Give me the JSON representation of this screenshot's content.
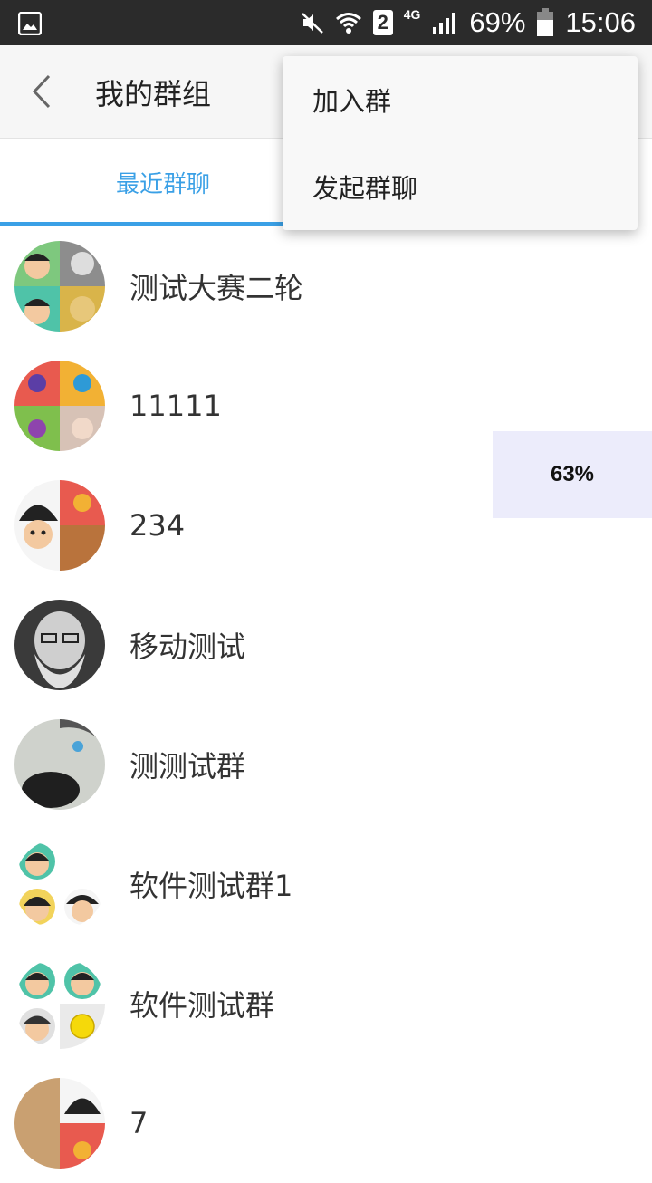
{
  "status_bar": {
    "battery": "69%",
    "time": "15:06",
    "sim_slot": "2",
    "network": "4G",
    "icons": [
      "image-icon",
      "mute-icon",
      "wifi-icon",
      "sim-icon",
      "signal-icon",
      "battery-icon"
    ]
  },
  "header": {
    "title": "我的群组",
    "back_icon": "chevron-left-icon"
  },
  "tabs": [
    {
      "label": "最近群聊",
      "active": true
    }
  ],
  "menu": {
    "items": [
      {
        "label": "加入群"
      },
      {
        "label": "发起群聊"
      }
    ]
  },
  "groups": [
    {
      "name": "测试大赛二轮"
    },
    {
      "name": "11111"
    },
    {
      "name": "234"
    },
    {
      "name": "移动测试"
    },
    {
      "name": "测测试群"
    },
    {
      "name": "软件测试群1"
    },
    {
      "name": "软件测试群"
    },
    {
      "name": "7"
    }
  ],
  "overlay": {
    "percent": "63%"
  },
  "colors": {
    "accent": "#3aa0e6",
    "status_bar": "#2b2b2b",
    "app_bar": "#f6f6f6",
    "overlay": "#ececfb"
  }
}
